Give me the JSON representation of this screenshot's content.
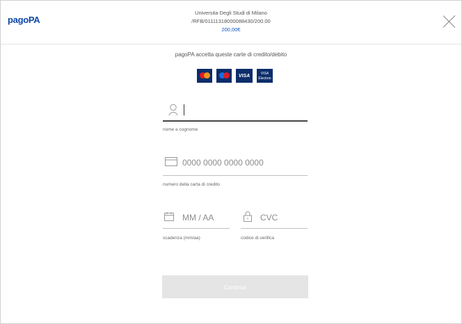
{
  "header": {
    "logo": "pagoPA",
    "merchant_name": "Universita Degli Studi di Milano",
    "reference": "/RFB/01111318000088430/200.00",
    "amount": "200,00€"
  },
  "accepted_text": "pagoPA accetta queste carte di credito/debito",
  "cards": [
    {
      "name": "mastercard",
      "label": ""
    },
    {
      "name": "maestro",
      "label": ""
    },
    {
      "name": "visa",
      "label": "VISA"
    },
    {
      "name": "visa-electron",
      "label": "VISA Electron"
    }
  ],
  "form": {
    "name": {
      "placeholder": "",
      "caption": "nome e cognome"
    },
    "card_number": {
      "placeholder": "0000 0000 0000 0000",
      "caption": "numero della carta di credito"
    },
    "expiry": {
      "placeholder": "MM / AA",
      "caption": "scadenza (mm/aa)"
    },
    "cvc": {
      "placeholder": "CVC",
      "caption": "codice di verifica"
    }
  },
  "continue_label": "Continua",
  "colors": {
    "brand": "#0d47a8",
    "amount": "#0a55c8",
    "button_disabled": "#e5e5e5"
  }
}
